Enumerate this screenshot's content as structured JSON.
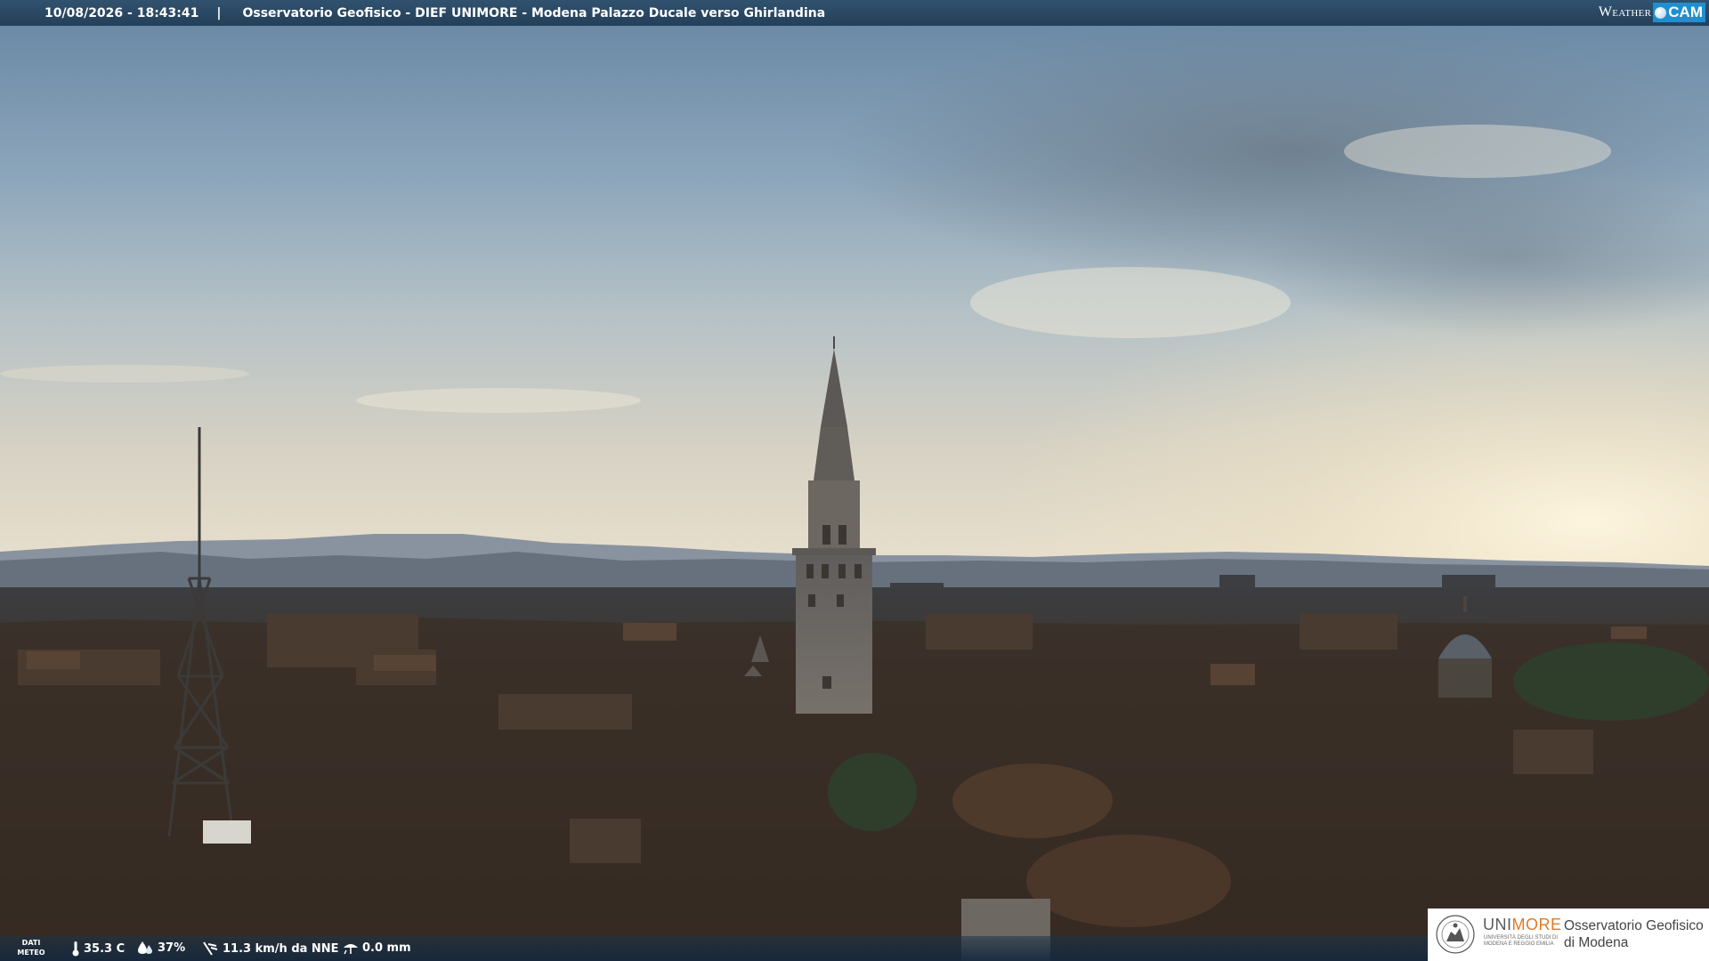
{
  "header": {
    "datetime": "10/08/2026 - 18:43:41",
    "separator": "|",
    "location": "Osservatorio Geofisico - DIEF UNIMORE - Modena Palazzo Ducale verso Ghirlandina",
    "brand_weather": "Weather",
    "brand_cam": "CAM"
  },
  "meteo": {
    "label_line1": "DATI",
    "label_line2": "METEO",
    "temperature": "35.3 C",
    "humidity": "37%",
    "wind": "11.3 km/h da NNE",
    "rain": "0.0 mm",
    "icons": [
      "thermometer-icon",
      "humidity-drop-icon",
      "wind-icon",
      "rain-gauge-icon"
    ]
  },
  "logo": {
    "uni": "UNI",
    "more": "MORE",
    "sub_line1": "UNIVERSITÀ DEGLI STUDI DI",
    "sub_line2": "MODENA E REGGIO EMILIA",
    "label_line1": "Osservatorio Geofisico",
    "label_line2": "di Modena"
  },
  "colors": {
    "header_bar": "#2b4a66",
    "brand_cam_bg": "#1f8fd0",
    "unimore_accent": "#e07a28"
  }
}
